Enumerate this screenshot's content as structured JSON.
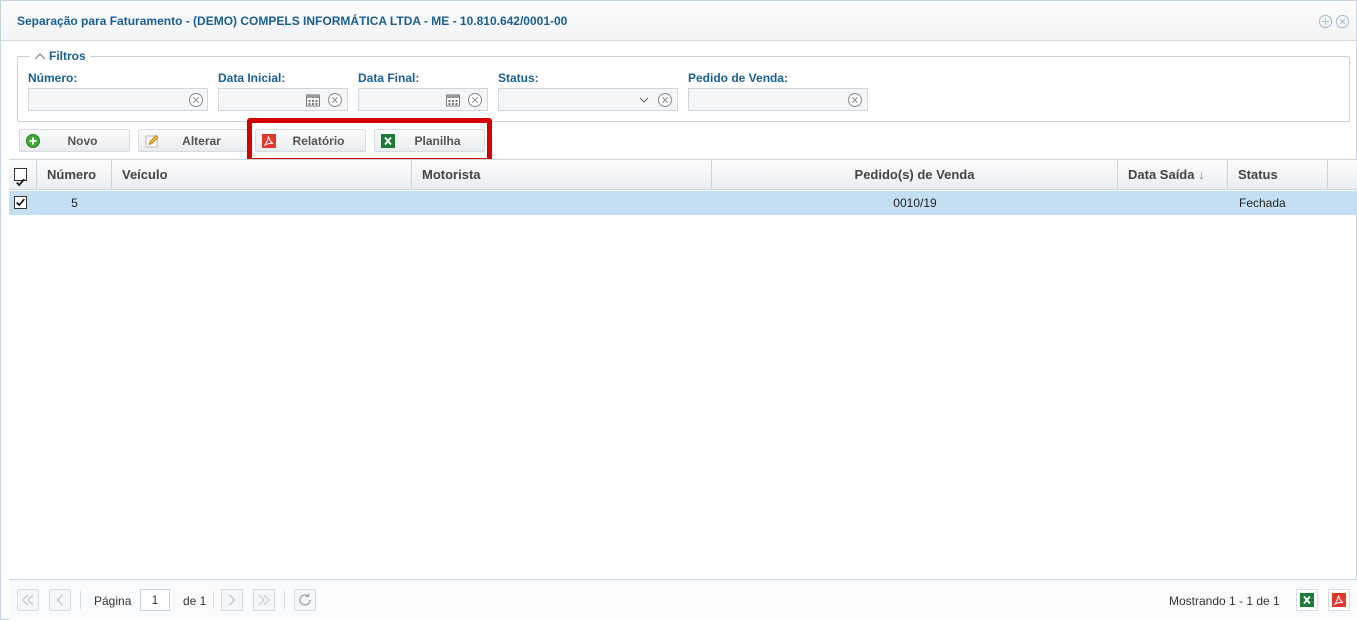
{
  "window": {
    "title": "Separação para Faturamento - (DEMO) COMPELS INFORMÁTICA LTDA - ME - 10.810.642/0001-00"
  },
  "filters": {
    "legend": "Filtros",
    "numero_label": "Número:",
    "numero_value": "",
    "data_inicial_label": "Data Inicial:",
    "data_inicial_value": "",
    "data_final_label": "Data Final:",
    "data_final_value": "",
    "status_label": "Status:",
    "status_value": "",
    "pedido_label": "Pedido de Venda:",
    "pedido_value": ""
  },
  "toolbar": {
    "novo": "Novo",
    "alterar": "Alterar",
    "relatorio": "Relatório",
    "planilha": "Planilha"
  },
  "grid": {
    "columns": [
      "Número",
      "Veículo",
      "Motorista",
      "Pedido(s) de Venda",
      "Data Saída",
      "Status"
    ],
    "sort_indicator": "↓",
    "rows": [
      {
        "numero": "5",
        "veiculo": "",
        "motorista": "",
        "pedidos": "0010/19",
        "data_saida": "",
        "status": "Fechada",
        "checked": true
      }
    ]
  },
  "pager": {
    "page_label": "Página",
    "page_value": "1",
    "of_label": "de 1",
    "showing": "Mostrando 1 - 1 de 1"
  },
  "colors": {
    "accent": "#1a5f91",
    "selected_row": "#c5dff2",
    "highlight": "#d40000",
    "pdf_red": "#e2372b",
    "excel_green": "#1d7a3a"
  }
}
